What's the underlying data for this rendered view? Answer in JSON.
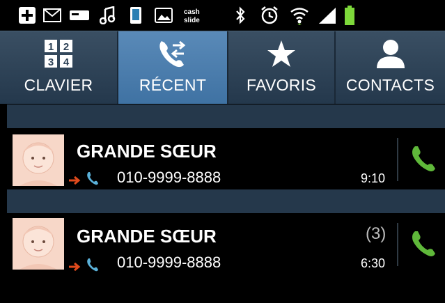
{
  "status_bar": {
    "icons": [
      "plus-icon",
      "mail-icon",
      "card-icon",
      "music-icon",
      "phone-device-icon",
      "image-icon",
      "cashslide-icon",
      "bluetooth-icon",
      "alarm-icon",
      "wifi-icon",
      "signal-icon",
      "battery-icon"
    ],
    "cashslide_text": "cash\nslide",
    "accent": "#7dd83a"
  },
  "tabs": [
    {
      "label": "CLAVIER",
      "icon": "dialpad-icon",
      "digits": [
        "1",
        "2",
        "3",
        "4"
      ],
      "active": false
    },
    {
      "label": "RÉCENT",
      "icon": "recent-calls-icon",
      "active": true
    },
    {
      "label": "FAVORIS",
      "icon": "star-icon",
      "active": false
    },
    {
      "label": "CONTACTS",
      "icon": "contact-icon",
      "active": false
    }
  ],
  "calls": [
    {
      "name": "GRANDE SŒUR",
      "number": "010-9999-8888",
      "time": "9:10",
      "count": ""
    },
    {
      "name": "GRANDE SŒUR",
      "number": "010-9999-8888",
      "time": "6:30",
      "count": "(3)"
    }
  ],
  "colors": {
    "active_tab": "#4a7fb0",
    "tab_bar": "#2d4257",
    "band": "#25384b",
    "call_green": "#5fb83a",
    "outgoing_arrow": "#e04a1c"
  }
}
